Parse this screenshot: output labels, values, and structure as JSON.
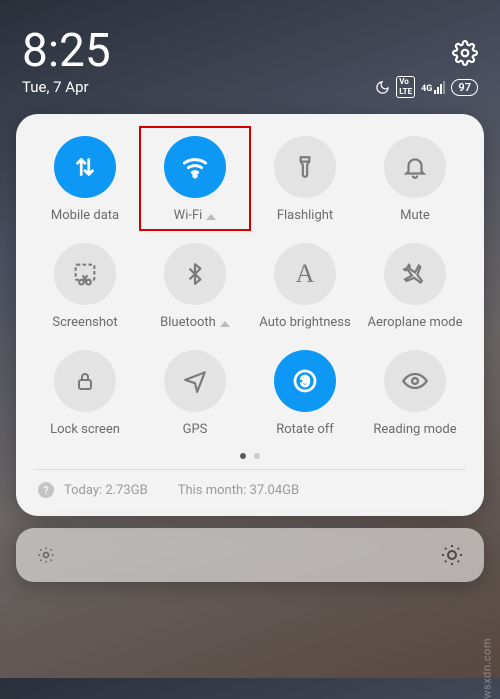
{
  "statusbar": {
    "time": "8:25",
    "date": "Tue, 7 Apr",
    "battery": "97",
    "signal_label": "4G",
    "volte": "Vo LTE"
  },
  "tiles": [
    {
      "id": "mobile-data",
      "label": "Mobile data",
      "active": true,
      "chevron": false,
      "icon": "arrows"
    },
    {
      "id": "wifi",
      "label": "Wi-Fi",
      "active": true,
      "chevron": true,
      "icon": "wifi",
      "highlight": true
    },
    {
      "id": "flashlight",
      "label": "Flashlight",
      "active": false,
      "chevron": false,
      "icon": "flashlight"
    },
    {
      "id": "mute",
      "label": "Mute",
      "active": false,
      "chevron": false,
      "icon": "bell"
    },
    {
      "id": "screenshot",
      "label": "Screenshot",
      "active": false,
      "chevron": false,
      "icon": "scissors"
    },
    {
      "id": "bluetooth",
      "label": "Bluetooth",
      "active": false,
      "chevron": true,
      "icon": "bluetooth"
    },
    {
      "id": "auto-bright",
      "label": "Auto brightness",
      "active": false,
      "chevron": false,
      "icon": "A"
    },
    {
      "id": "aeroplane",
      "label": "Aeroplane mode",
      "active": false,
      "chevron": false,
      "icon": "plane"
    },
    {
      "id": "lockscreen",
      "label": "Lock screen",
      "active": false,
      "chevron": false,
      "icon": "lock"
    },
    {
      "id": "gps",
      "label": "GPS",
      "active": false,
      "chevron": false,
      "icon": "nav"
    },
    {
      "id": "rotate",
      "label": "Rotate off",
      "active": true,
      "chevron": false,
      "icon": "rotate"
    },
    {
      "id": "reading",
      "label": "Reading mode",
      "active": false,
      "chevron": false,
      "icon": "eye"
    }
  ],
  "usage": {
    "today_label": "Today:",
    "today_value": "2.73GB",
    "month_label": "This month:",
    "month_value": "37.04GB"
  },
  "watermark": "wsxdn.com"
}
